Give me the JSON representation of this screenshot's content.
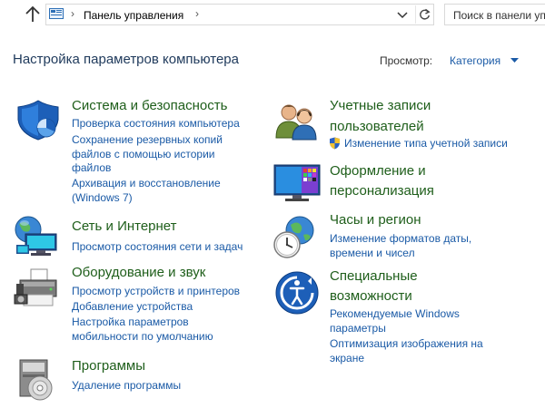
{
  "address_bar": {
    "path_label": "Панель управления",
    "search_placeholder": "Поиск в панели управления"
  },
  "header": {
    "title": "Настройка параметров компьютера",
    "view_by_label": "Просмотр:",
    "view_by_value": "Категория"
  },
  "categories": {
    "system_security": {
      "heading": "Система и безопасность",
      "links": [
        "Проверка состояния компьютера",
        "Сохранение резервных копий",
        "файлов с помощью истории",
        "файлов",
        "Архивация и восстановление",
        "(Windows 7)"
      ]
    },
    "network": {
      "heading": "Сеть и Интернет",
      "links": [
        "Просмотр состояния сети и задач"
      ]
    },
    "hardware": {
      "heading": "Оборудование и звук",
      "links": [
        "Просмотр устройств и принтеров",
        "Добавление устройства",
        "Настройка параметров",
        "мобильности по умолчанию"
      ]
    },
    "programs": {
      "heading": "Программы",
      "links": [
        "Удаление программы"
      ]
    },
    "user_accounts": {
      "heading_line1": "Учетные записи",
      "heading_line2": "пользователей",
      "links": [
        "Изменение типа учетной записи"
      ]
    },
    "appearance": {
      "heading_line1": "Оформление и",
      "heading_line2": "персонализация"
    },
    "clock_region": {
      "heading": "Часы и регион",
      "links": [
        "Изменение форматов даты,",
        "времени и чисел"
      ]
    },
    "ease_of_access": {
      "heading_line1": "Специальные",
      "heading_line2": "возможности",
      "links": [
        "Рекомендуемые Windows",
        "параметры",
        "Оптимизация изображения на",
        "экране"
      ]
    }
  },
  "colors": {
    "heading_green": "#1e5e1a",
    "link_blue": "#1a5aa6",
    "title_blue": "#1e395b"
  }
}
